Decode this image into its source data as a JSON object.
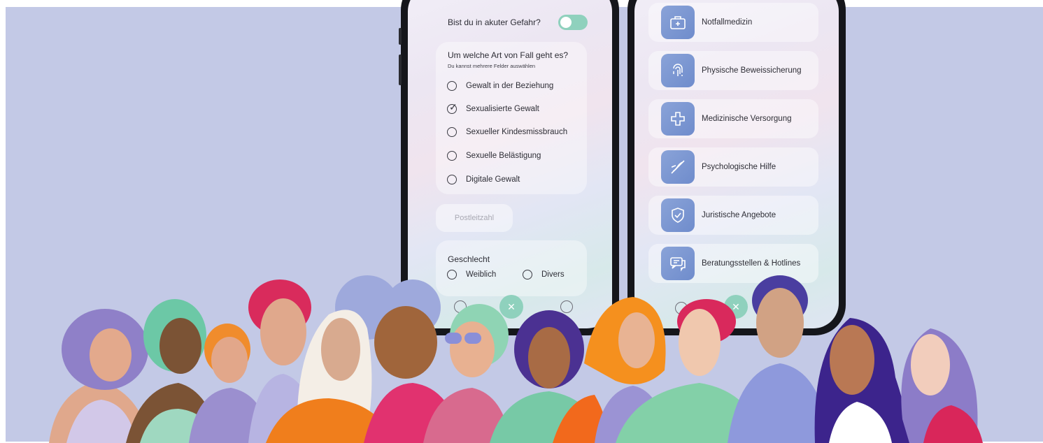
{
  "danger": {
    "question": "Bist du in akuter Gefahr?",
    "toggle_on": true
  },
  "case": {
    "title": "Um welche Art von Fall geht es?",
    "subtitle": "Du kannst mehrere Felder auswählen",
    "options": [
      {
        "label": "Gewalt in der Beziehung",
        "checked": false
      },
      {
        "label": "Sexualisierte Gewalt",
        "checked": true
      },
      {
        "label": "Sexueller Kindesmissbrauch",
        "checked": false
      },
      {
        "label": "Sexuelle Belästigung",
        "checked": false
      },
      {
        "label": "Digitale Gewalt",
        "checked": false
      }
    ]
  },
  "postcode": {
    "placeholder": "Postleitzahl"
  },
  "gender": {
    "title": "Geschlecht",
    "options": [
      "Weiblich",
      "Divers"
    ]
  },
  "services": [
    {
      "label": "Notfallmedizin",
      "icon": "medical-kit-icon"
    },
    {
      "label": "Physische Beweissicherung",
      "icon": "fingerprint-icon"
    },
    {
      "label": "Medizinische Versorgung",
      "icon": "medical-care-icon"
    },
    {
      "label": "Psychologische Hilfe",
      "icon": "psychology-icon"
    },
    {
      "label": "Juristische Angebote",
      "icon": "legal-shield-icon"
    },
    {
      "label": "Beratungsstellen & Hotlines",
      "icon": "chat-bubbles-icon"
    }
  ],
  "colors": {
    "background": "#c3c9e6",
    "accent": "#8fd1bd",
    "icon_tile": "#7b97d1"
  }
}
